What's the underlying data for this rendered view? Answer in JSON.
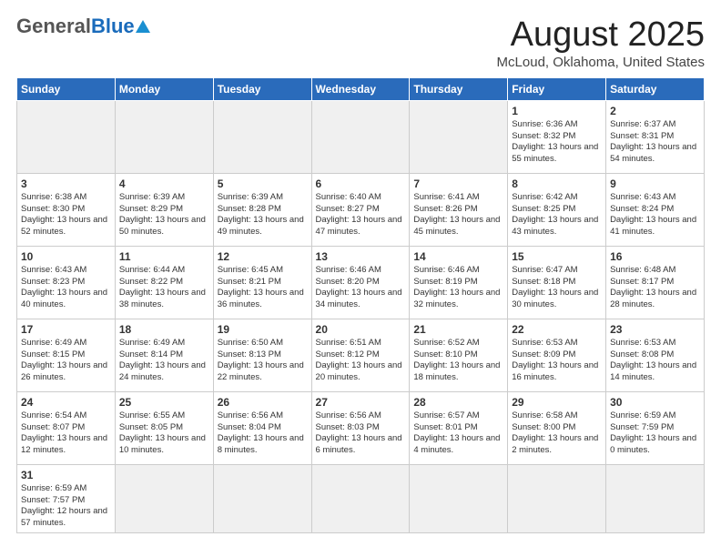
{
  "header": {
    "logo_general": "General",
    "logo_blue": "Blue",
    "main_title": "August 2025",
    "sub_title": "McLoud, Oklahoma, United States"
  },
  "weekdays": [
    "Sunday",
    "Monday",
    "Tuesday",
    "Wednesday",
    "Thursday",
    "Friday",
    "Saturday"
  ],
  "weeks": [
    [
      {
        "day": "",
        "info": "",
        "empty": true
      },
      {
        "day": "",
        "info": "",
        "empty": true
      },
      {
        "day": "",
        "info": "",
        "empty": true
      },
      {
        "day": "",
        "info": "",
        "empty": true
      },
      {
        "day": "",
        "info": "",
        "empty": true
      },
      {
        "day": "1",
        "info": "Sunrise: 6:36 AM\nSunset: 8:32 PM\nDaylight: 13 hours\nand 55 minutes."
      },
      {
        "day": "2",
        "info": "Sunrise: 6:37 AM\nSunset: 8:31 PM\nDaylight: 13 hours\nand 54 minutes."
      }
    ],
    [
      {
        "day": "3",
        "info": "Sunrise: 6:38 AM\nSunset: 8:30 PM\nDaylight: 13 hours\nand 52 minutes."
      },
      {
        "day": "4",
        "info": "Sunrise: 6:39 AM\nSunset: 8:29 PM\nDaylight: 13 hours\nand 50 minutes."
      },
      {
        "day": "5",
        "info": "Sunrise: 6:39 AM\nSunset: 8:28 PM\nDaylight: 13 hours\nand 49 minutes."
      },
      {
        "day": "6",
        "info": "Sunrise: 6:40 AM\nSunset: 8:27 PM\nDaylight: 13 hours\nand 47 minutes."
      },
      {
        "day": "7",
        "info": "Sunrise: 6:41 AM\nSunset: 8:26 PM\nDaylight: 13 hours\nand 45 minutes."
      },
      {
        "day": "8",
        "info": "Sunrise: 6:42 AM\nSunset: 8:25 PM\nDaylight: 13 hours\nand 43 minutes."
      },
      {
        "day": "9",
        "info": "Sunrise: 6:43 AM\nSunset: 8:24 PM\nDaylight: 13 hours\nand 41 minutes."
      }
    ],
    [
      {
        "day": "10",
        "info": "Sunrise: 6:43 AM\nSunset: 8:23 PM\nDaylight: 13 hours\nand 40 minutes."
      },
      {
        "day": "11",
        "info": "Sunrise: 6:44 AM\nSunset: 8:22 PM\nDaylight: 13 hours\nand 38 minutes."
      },
      {
        "day": "12",
        "info": "Sunrise: 6:45 AM\nSunset: 8:21 PM\nDaylight: 13 hours\nand 36 minutes."
      },
      {
        "day": "13",
        "info": "Sunrise: 6:46 AM\nSunset: 8:20 PM\nDaylight: 13 hours\nand 34 minutes."
      },
      {
        "day": "14",
        "info": "Sunrise: 6:46 AM\nSunset: 8:19 PM\nDaylight: 13 hours\nand 32 minutes."
      },
      {
        "day": "15",
        "info": "Sunrise: 6:47 AM\nSunset: 8:18 PM\nDaylight: 13 hours\nand 30 minutes."
      },
      {
        "day": "16",
        "info": "Sunrise: 6:48 AM\nSunset: 8:17 PM\nDaylight: 13 hours\nand 28 minutes."
      }
    ],
    [
      {
        "day": "17",
        "info": "Sunrise: 6:49 AM\nSunset: 8:15 PM\nDaylight: 13 hours\nand 26 minutes."
      },
      {
        "day": "18",
        "info": "Sunrise: 6:49 AM\nSunset: 8:14 PM\nDaylight: 13 hours\nand 24 minutes."
      },
      {
        "day": "19",
        "info": "Sunrise: 6:50 AM\nSunset: 8:13 PM\nDaylight: 13 hours\nand 22 minutes."
      },
      {
        "day": "20",
        "info": "Sunrise: 6:51 AM\nSunset: 8:12 PM\nDaylight: 13 hours\nand 20 minutes."
      },
      {
        "day": "21",
        "info": "Sunrise: 6:52 AM\nSunset: 8:10 PM\nDaylight: 13 hours\nand 18 minutes."
      },
      {
        "day": "22",
        "info": "Sunrise: 6:53 AM\nSunset: 8:09 PM\nDaylight: 13 hours\nand 16 minutes."
      },
      {
        "day": "23",
        "info": "Sunrise: 6:53 AM\nSunset: 8:08 PM\nDaylight: 13 hours\nand 14 minutes."
      }
    ],
    [
      {
        "day": "24",
        "info": "Sunrise: 6:54 AM\nSunset: 8:07 PM\nDaylight: 13 hours\nand 12 minutes."
      },
      {
        "day": "25",
        "info": "Sunrise: 6:55 AM\nSunset: 8:05 PM\nDaylight: 13 hours\nand 10 minutes."
      },
      {
        "day": "26",
        "info": "Sunrise: 6:56 AM\nSunset: 8:04 PM\nDaylight: 13 hours\nand 8 minutes."
      },
      {
        "day": "27",
        "info": "Sunrise: 6:56 AM\nSunset: 8:03 PM\nDaylight: 13 hours\nand 6 minutes."
      },
      {
        "day": "28",
        "info": "Sunrise: 6:57 AM\nSunset: 8:01 PM\nDaylight: 13 hours\nand 4 minutes."
      },
      {
        "day": "29",
        "info": "Sunrise: 6:58 AM\nSunset: 8:00 PM\nDaylight: 13 hours\nand 2 minutes."
      },
      {
        "day": "30",
        "info": "Sunrise: 6:59 AM\nSunset: 7:59 PM\nDaylight: 13 hours\nand 0 minutes."
      }
    ],
    [
      {
        "day": "31",
        "info": "Sunrise: 6:59 AM\nSunset: 7:57 PM\nDaylight: 12 hours\nand 57 minutes.",
        "last": true
      },
      {
        "day": "",
        "info": "",
        "empty": true,
        "last": true
      },
      {
        "day": "",
        "info": "",
        "empty": true,
        "last": true
      },
      {
        "day": "",
        "info": "",
        "empty": true,
        "last": true
      },
      {
        "day": "",
        "info": "",
        "empty": true,
        "last": true
      },
      {
        "day": "",
        "info": "",
        "empty": true,
        "last": true
      },
      {
        "day": "",
        "info": "",
        "empty": true,
        "last": true
      }
    ]
  ]
}
